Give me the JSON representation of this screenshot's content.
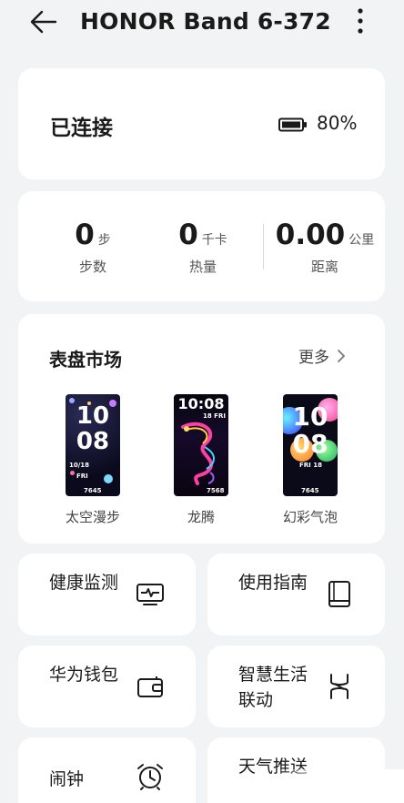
{
  "header": {
    "title": "HONOR Band 6-372"
  },
  "connection": {
    "status": "已连接",
    "battery_percent": "80%"
  },
  "stats": [
    {
      "value": "0",
      "unit": "步",
      "label": "步数"
    },
    {
      "value": "0",
      "unit": "千卡",
      "label": "热量"
    },
    {
      "value": "0.00",
      "unit": "公里",
      "label": "距离"
    }
  ],
  "watch_faces": {
    "title": "表盘市场",
    "more_label": "更多",
    "items": [
      {
        "name": "太空漫步",
        "time_h": "10",
        "time_m": "08",
        "date": "10/18",
        "day": "FRI",
        "steps": "7645"
      },
      {
        "name": "龙腾",
        "time": "10:08",
        "date": "18 FRI",
        "steps": "7568"
      },
      {
        "name": "幻彩气泡",
        "time_h": "10",
        "time_m": "08",
        "date": "FRI 18",
        "steps": "7645"
      }
    ]
  },
  "tiles": [
    {
      "label": "健康监测",
      "icon": "health-monitor-icon"
    },
    {
      "label": "使用指南",
      "icon": "guide-book-icon"
    },
    {
      "label": "华为钱包",
      "icon": "wallet-icon"
    },
    {
      "label": "智慧生活联动",
      "icon": "smart-life-icon"
    },
    {
      "label": "闹钟",
      "icon": "alarm-clock-icon"
    },
    {
      "label": "天气推送",
      "icon": "weather-icon"
    }
  ]
}
